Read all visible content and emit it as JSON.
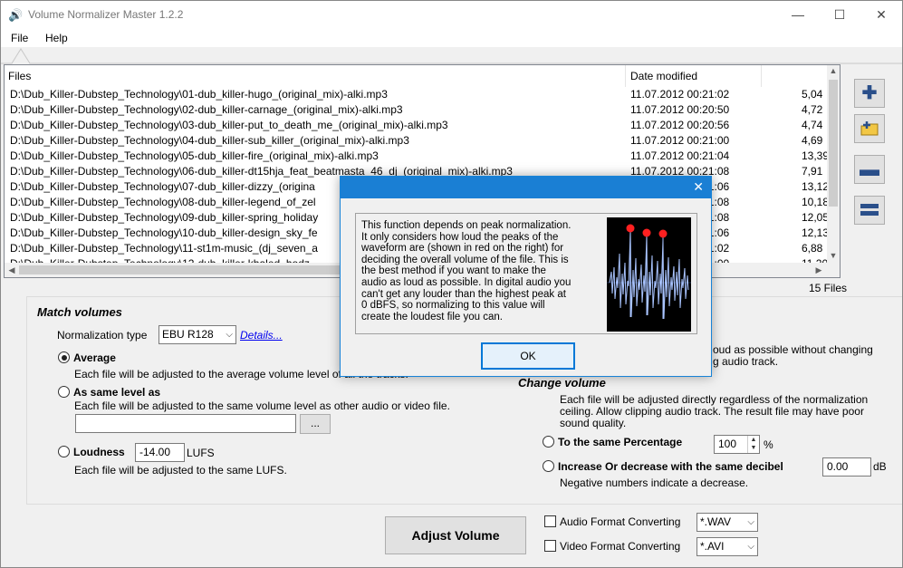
{
  "window": {
    "title": "Volume Normalizer Master 1.2.2",
    "minimize": "—",
    "maximize": "☐",
    "close": "✕"
  },
  "menu": {
    "file": "File",
    "help": "Help"
  },
  "filelist": {
    "headers": {
      "files": "Files",
      "date": "Date modified"
    },
    "rows": [
      {
        "path": "D:\\Dub_Killer-Dubstep_Technology\\01-dub_killer-hugo_(original_mix)-alki.mp3",
        "date": "11.07.2012 00:21:02",
        "size": "5,04"
      },
      {
        "path": "D:\\Dub_Killer-Dubstep_Technology\\02-dub_killer-carnage_(original_mix)-alki.mp3",
        "date": "11.07.2012 00:20:50",
        "size": "4,72"
      },
      {
        "path": "D:\\Dub_Killer-Dubstep_Technology\\03-dub_killer-put_to_death_me_(original_mix)-alki.mp3",
        "date": "11.07.2012 00:20:56",
        "size": "4,74"
      },
      {
        "path": "D:\\Dub_Killer-Dubstep_Technology\\04-dub_killer-sub_killer_(original_mix)-alki.mp3",
        "date": "11.07.2012 00:21:00",
        "size": "4,69"
      },
      {
        "path": "D:\\Dub_Killer-Dubstep_Technology\\05-dub_killer-fire_(original_mix)-alki.mp3",
        "date": "11.07.2012 00:21:04",
        "size": "13,39"
      },
      {
        "path": "D:\\Dub_Killer-Dubstep_Technology\\06-dub_killer-dt15hja_feat_beatmasta_46_dj_(original_mix)-alki.mp3",
        "date": "11.07.2012 00:21:08",
        "size": "7,91"
      },
      {
        "path": "D:\\Dub_Killer-Dubstep_Technology\\07-dub_killer-dizzy_(origina",
        "date": "11.07.2012 00:21:06",
        "size": "13,12"
      },
      {
        "path": "D:\\Dub_Killer-Dubstep_Technology\\08-dub_killer-legend_of_zel",
        "date": "11.07.2012 00:21:08",
        "size": "10,18"
      },
      {
        "path": "D:\\Dub_Killer-Dubstep_Technology\\09-dub_killer-spring_holiday",
        "date": "11.07.2012 00:21:08",
        "size": "12,05"
      },
      {
        "path": "D:\\Dub_Killer-Dubstep_Technology\\10-dub_killer-design_sky_fe",
        "date": "11.07.2012 00:21:06",
        "size": "12,13"
      },
      {
        "path": "D:\\Dub_Killer-Dubstep_Technology\\11-st1m-music_(dj_seven_a",
        "date": "11.07.2012 00:21:02",
        "size": "6,88"
      },
      {
        "path": "D:\\Dub_Killer-Dubstep_Technology\\12-dub_killer-khaled_hodz",
        "date": "11.07.2012 00:21:00",
        "size": "11,20"
      }
    ],
    "count": "15 Files"
  },
  "match": {
    "title": "Match volumes",
    "norm_type_label": "Normalization type",
    "norm_type_value": "EBU R128",
    "details_link": "Details...",
    "average_label": "Average",
    "average_desc": "Each file will be adjusted to the average volume level of all the tracks.",
    "same_level_label": "As same level as",
    "same_level_desc": "Each file will be adjusted to the same volume level as other audio or video file.",
    "same_level_value": "",
    "browse_label": "...",
    "loudness_label": "Loudness",
    "loudness_value": "-14.00",
    "loudness_unit": "LUFS",
    "loudness_desc": "Each file will be adjusted to the same LUFS."
  },
  "right": {
    "peak_desc_line1": "oud as possible without changing",
    "peak_desc_line2": "g audio track.",
    "change_title": "Change volume",
    "change_desc1": "Each file will be adjusted directly regardless of the normalization",
    "change_desc2": "ceiling. Allow clipping audio track. The result file may have poor",
    "change_desc3": "sound quality.",
    "percentage_label": "To the same Percentage",
    "percentage_value": "100",
    "percentage_unit": "%",
    "decibel_label": "Increase Or decrease with the same decibel",
    "decibel_value": "0.00",
    "decibel_unit": "dB",
    "decibel_note": "Negative numbers indicate a decrease."
  },
  "bottom": {
    "adjust_label": "Adjust Volume",
    "audio_convert_label": "Audio Format Converting",
    "audio_convert_value": "*.WAV",
    "video_convert_label": "Video Format Converting",
    "video_convert_value": "*.AVI"
  },
  "dialog": {
    "close": "✕",
    "lines": [
      "This function depends on peak normalization.",
      "It only considers how loud the peaks of the",
      "waveform are (shown in red on the right) for",
      "deciding the overall volume of the file. This is",
      "the best method if you want to make the",
      "audio as loud as possible. In digital audio you",
      "can't get any louder than the highest peak at",
      "0 dBFS, so normalizing to this value will",
      "create the loudest file you can."
    ],
    "ok_label": "OK"
  },
  "colors": {
    "accent": "#1a7fd4",
    "peak": "#ff2020",
    "wave": "#a9c4ff"
  },
  "icons": {
    "app": "speaker-icon",
    "add_file": "plus-icon",
    "add_folder": "folder-add-icon",
    "remove": "minus-icon",
    "clear": "clear-list-icon"
  }
}
